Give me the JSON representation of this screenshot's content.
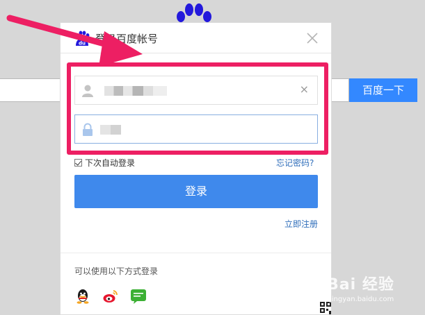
{
  "background": {
    "search_button_label": "百度一下"
  },
  "dialog": {
    "title": "登录百度帐号",
    "username_clear": "×",
    "remember_label": "下次自动登录",
    "remember_checked": true,
    "forgot_link": "忘记密码?",
    "login_button": "登录",
    "register_link": "立即注册",
    "alt_login_label": "可以使用以下方式登录",
    "social_icons": [
      "qq-icon",
      "weibo-icon",
      "wechat-icon"
    ]
  },
  "colors": {
    "accent": "#3f89ec",
    "highlight": "#ed1f63",
    "link": "#2e6dba"
  },
  "watermark": {
    "brand": "Bai 经验",
    "url": "jingyan.baidu.com"
  }
}
